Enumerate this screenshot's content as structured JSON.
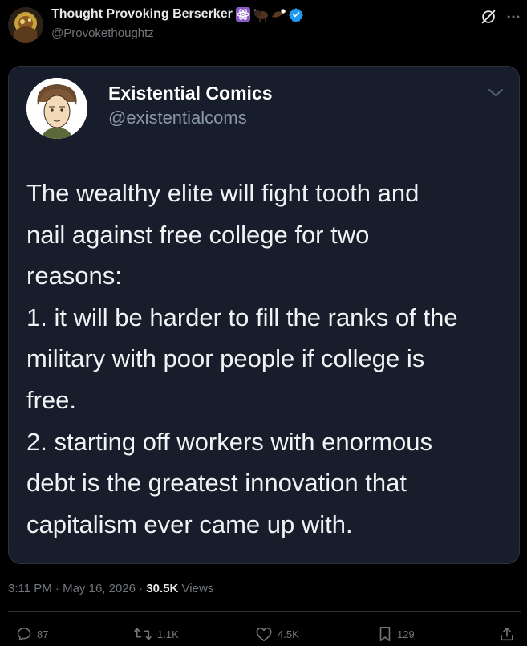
{
  "author": {
    "display_name": "Thought Provoking Berserker",
    "handle": "@Provokethoughtz",
    "emoji_icons": [
      "atom-symbol-icon",
      "bison-icon",
      "eagle-icon"
    ],
    "verified_icon": "verified-badge-icon"
  },
  "header_icons": [
    "grok-icon",
    "more-options-icon"
  ],
  "quoted": {
    "display_name": "Existential Comics",
    "handle": "@existentialcoms",
    "text_lines": [
      "The wealthy elite will fight tooth and",
      "nail against free college for two",
      "reasons:",
      "1. it will be harder to fill the ranks of the",
      "military with poor people if college is",
      "free.",
      "2. starting off workers with enormous",
      "debt is the greatest innovation that",
      "capitalism ever came up with."
    ]
  },
  "meta": {
    "time": "3:11 PM",
    "separator": "·",
    "date": "May 16, 2026",
    "views_count": "30.5K",
    "views_label": "Views"
  },
  "actions": {
    "replies": "87",
    "reposts": "1.1K",
    "likes": "4.5K",
    "bookmarks": "129"
  },
  "colors": {
    "background": "#000000",
    "card_background": "#171d2b",
    "verified_blue": "#1d9bf0",
    "muted_text": "#71767b"
  }
}
